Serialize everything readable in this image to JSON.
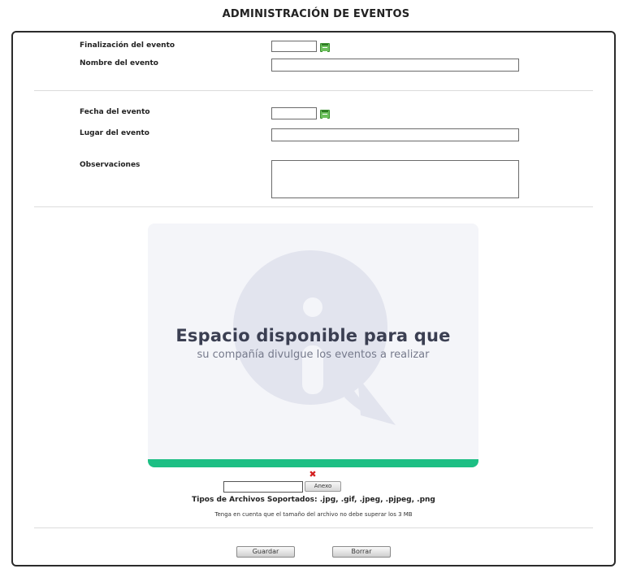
{
  "page": {
    "title": "ADMINISTRACIÓN DE EVENTOS"
  },
  "form": {
    "end_date_label": "Finalización del evento",
    "end_date_value": "",
    "event_name_label": "Nombre del evento",
    "event_name_value": "",
    "event_date_label": "Fecha del evento",
    "event_date_value": "",
    "event_place_label": "Lugar del evento",
    "event_place_value": "",
    "notes_label": "Observaciones",
    "notes_value": ""
  },
  "banner": {
    "headline": "Espacio disponible para que",
    "subline": "su compañía divulgue los eventos a realizar",
    "accent_color": "#1dbf84"
  },
  "upload": {
    "button_label": "Anexo",
    "supported_types": "Tipos de Archivos Soportados: .jpg, .gif, .jpeg, .pjpeg, .png",
    "size_note": "Tenga en cuenta que el tamaño del archivo no debe superar los 3 MB"
  },
  "actions": {
    "save_label": "Guardar",
    "clear_label": "Borrar"
  },
  "icons": {
    "calendar": "calendar-icon",
    "remove": "close-x-icon",
    "info": "info-bubble-icon"
  }
}
